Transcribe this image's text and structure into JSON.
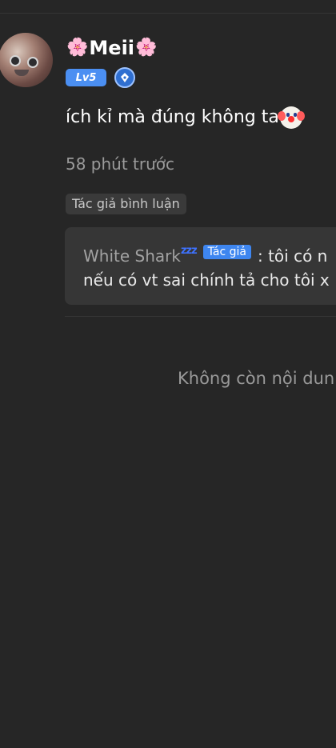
{
  "header": {
    "divider": true
  },
  "comment": {
    "username": "Meii",
    "username_decoration": "🌸",
    "level_badge": "Lv5",
    "pen_icon": "pen-icon",
    "text": "ích kỉ mà đúng không ta",
    "emoji": "clown-face",
    "time": "58 phút trước",
    "author_commented_tag": "Tác giả bình luận"
  },
  "reply": {
    "author_name": "White Shark",
    "sleep_icon": "zzz",
    "author_badge": "Tác giả",
    "line1_text": ": tôi có n",
    "line2_text": "nếu có vt sai chính tả cho tôi x"
  },
  "footer": {
    "end_text": "Không còn nội dun"
  },
  "colors": {
    "background": "#262626",
    "accent_blue": "#4b8ff2",
    "muted_text": "#9a9a9a",
    "reply_box": "#363636"
  }
}
